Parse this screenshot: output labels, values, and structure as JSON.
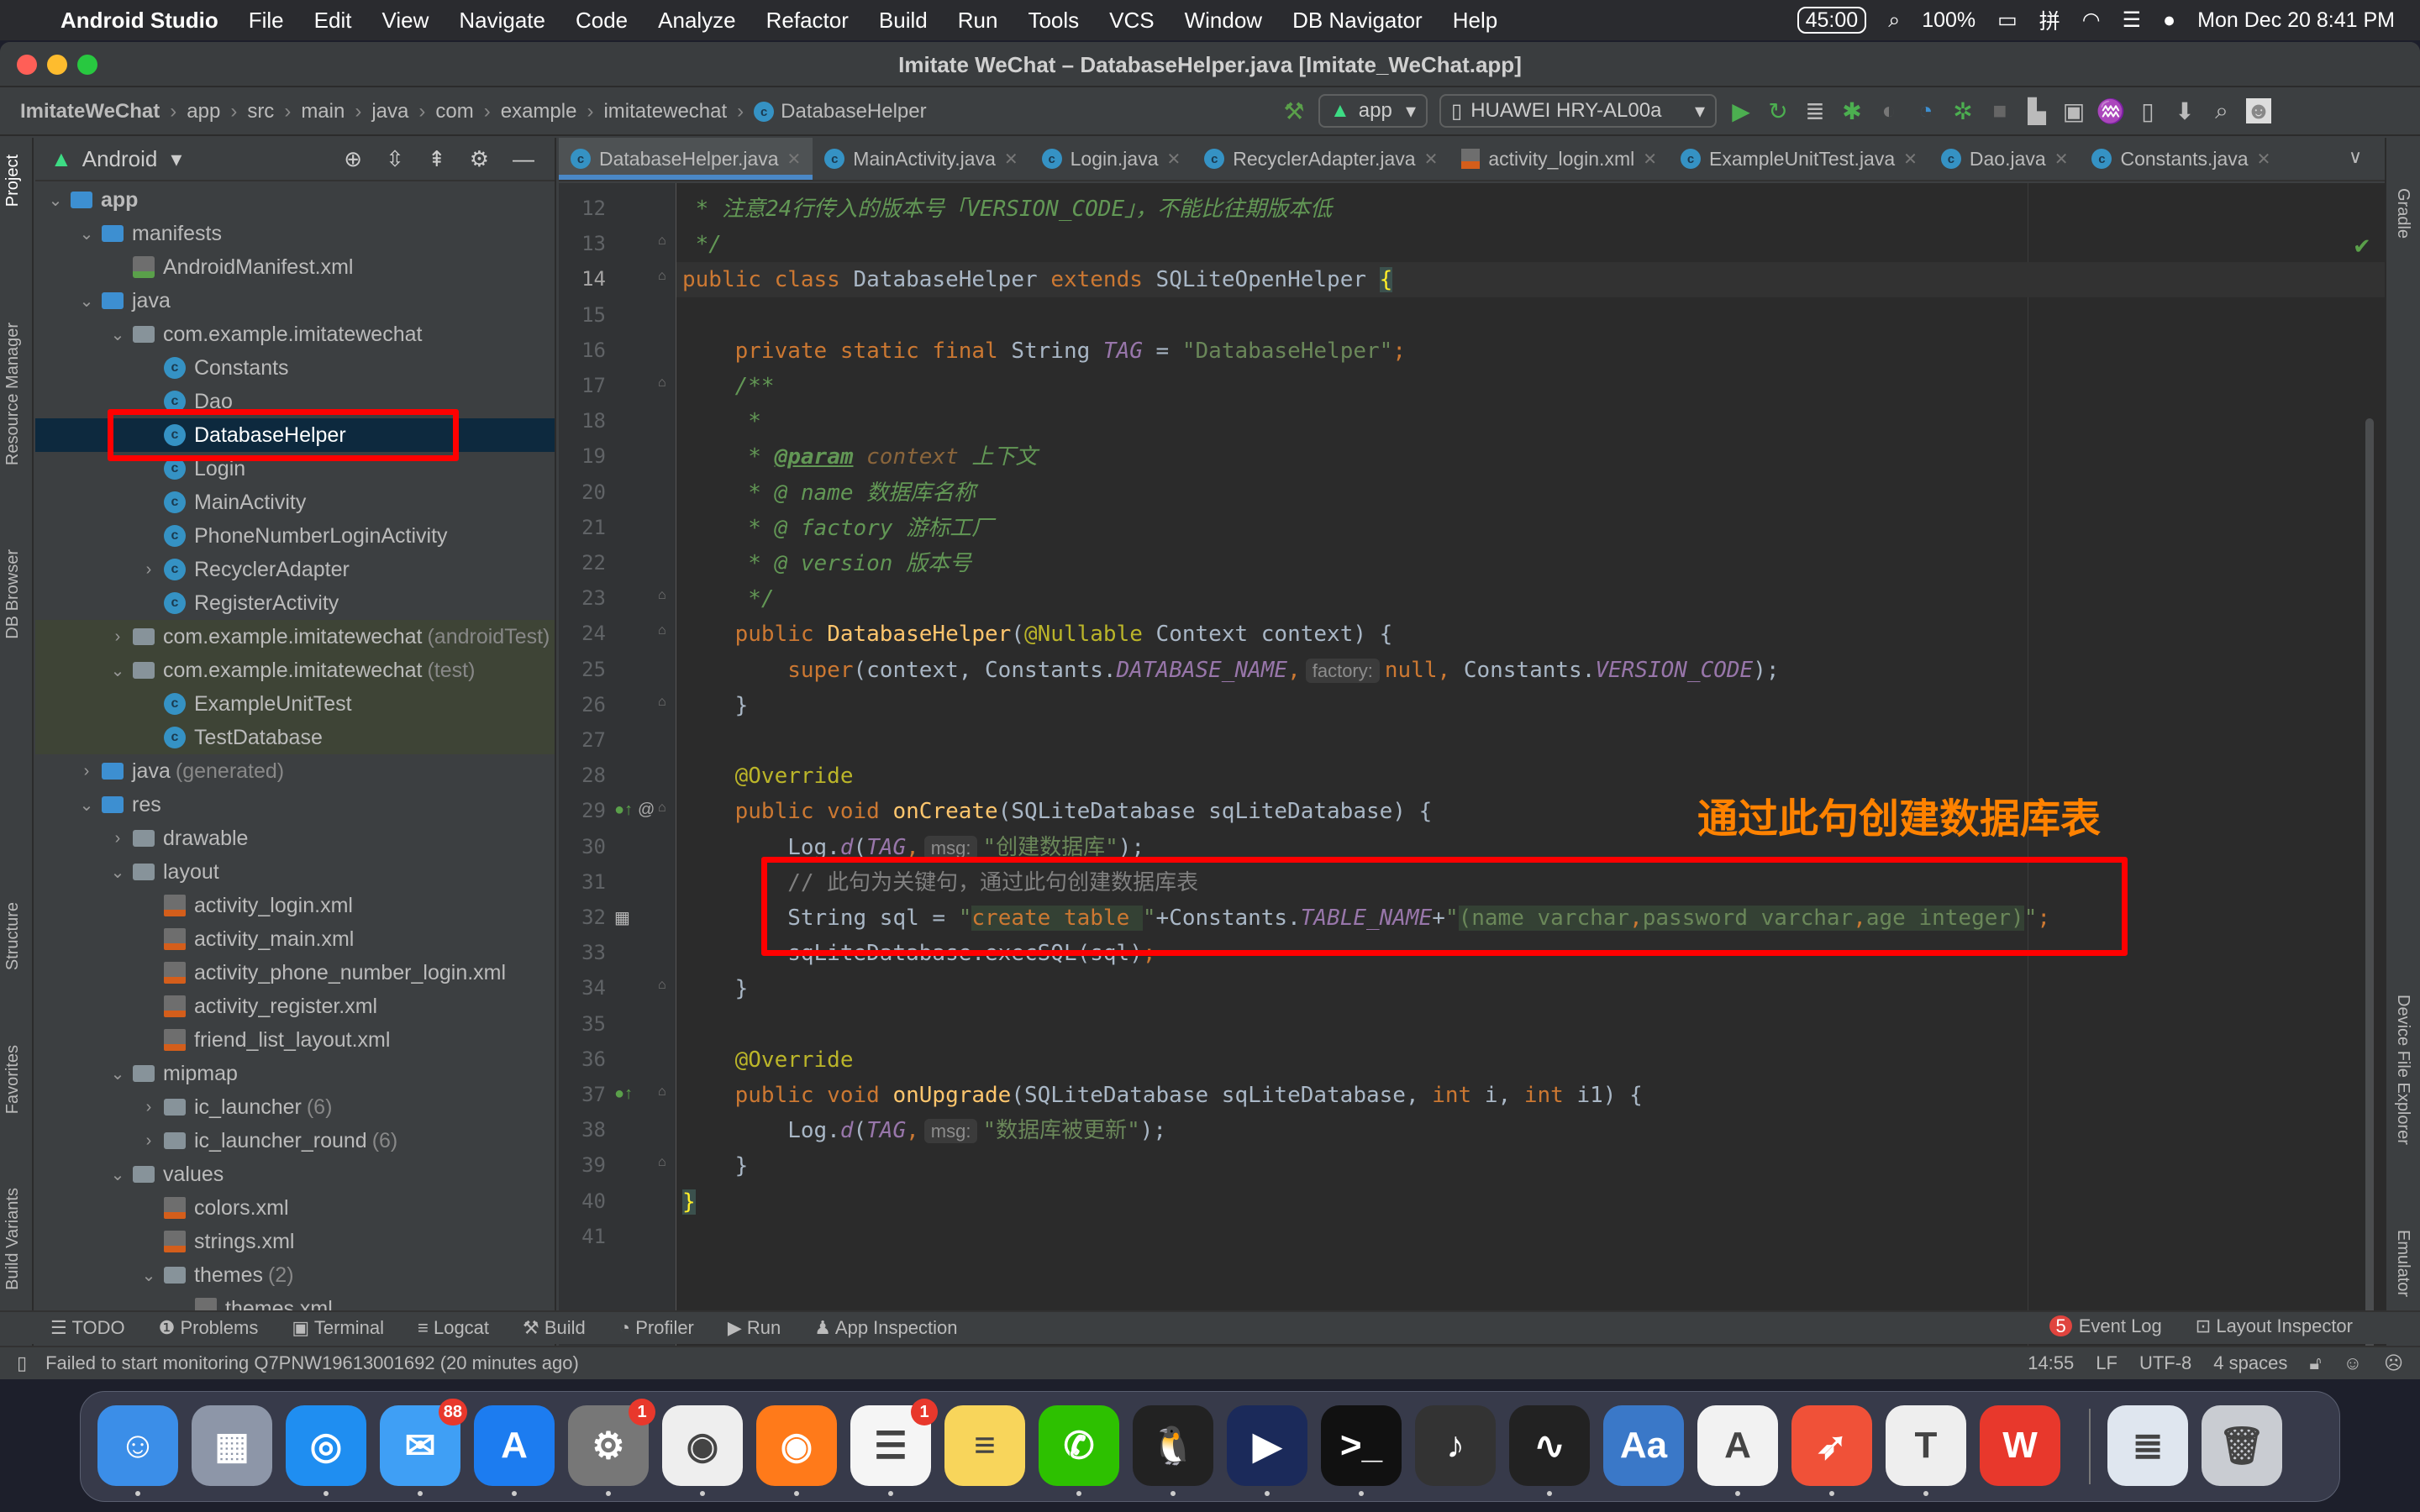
{
  "menubar": {
    "app_name": "Android Studio",
    "items": [
      "File",
      "Edit",
      "View",
      "Navigate",
      "Code",
      "Analyze",
      "Refactor",
      "Build",
      "Run",
      "Tools",
      "VCS",
      "Window",
      "DB Navigator",
      "Help"
    ],
    "timer": "45:00",
    "battery": "100%",
    "datetime": "Mon Dec 20  8:41 PM"
  },
  "window": {
    "title": "Imitate WeChat – DatabaseHelper.java [Imitate_WeChat.app]"
  },
  "breadcrumb": [
    "ImitateWeChat",
    "app",
    "src",
    "main",
    "java",
    "com",
    "example",
    "imitatewechat",
    "DatabaseHelper"
  ],
  "toolbar": {
    "run_config": "app",
    "device": "HUAWEI HRY-AL00a"
  },
  "left_tool_windows": [
    "Project",
    "Resource Manager",
    "DB Browser",
    "Structure",
    "Favorites",
    "Build Variants"
  ],
  "right_tool_windows": [
    "Gradle",
    "Device File Explorer",
    "Emulator"
  ],
  "project_panel": {
    "view": "Android",
    "tree": [
      {
        "level": 0,
        "arrow": "open",
        "icon": "folderb",
        "label": "app",
        "bold": true
      },
      {
        "level": 1,
        "arrow": "open",
        "icon": "folderb",
        "label": "manifests"
      },
      {
        "level": 2,
        "arrow": "",
        "icon": "man",
        "label": "AndroidManifest.xml"
      },
      {
        "level": 1,
        "arrow": "open",
        "icon": "folderb",
        "label": "java"
      },
      {
        "level": 2,
        "arrow": "open",
        "icon": "pkg",
        "label": "com.example.imitatewechat"
      },
      {
        "level": 3,
        "arrow": "",
        "icon": "cls",
        "label": "Constants"
      },
      {
        "level": 3,
        "arrow": "",
        "icon": "cls",
        "label": "Dao"
      },
      {
        "level": 3,
        "arrow": "",
        "icon": "cls",
        "label": "DatabaseHelper",
        "selected": true
      },
      {
        "level": 3,
        "arrow": "",
        "icon": "cls",
        "label": "Login"
      },
      {
        "level": 3,
        "arrow": "",
        "icon": "cls",
        "label": "MainActivity"
      },
      {
        "level": 3,
        "arrow": "",
        "icon": "cls",
        "label": "PhoneNumberLoginActivity"
      },
      {
        "level": 3,
        "arrow": "closed",
        "icon": "cls",
        "label": "RecyclerAdapter"
      },
      {
        "level": 3,
        "arrow": "",
        "icon": "cls",
        "label": "RegisterActivity"
      },
      {
        "level": 2,
        "arrow": "closed",
        "icon": "pkg",
        "label": "com.example.imitatewechat",
        "secondary": "(androidTest)",
        "test": true
      },
      {
        "level": 2,
        "arrow": "open",
        "icon": "pkg",
        "label": "com.example.imitatewechat",
        "secondary": "(test)",
        "test": true
      },
      {
        "level": 3,
        "arrow": "",
        "icon": "cls",
        "label": "ExampleUnitTest",
        "test": true
      },
      {
        "level": 3,
        "arrow": "",
        "icon": "cls",
        "label": "TestDatabase",
        "test": true
      },
      {
        "level": 1,
        "arrow": "closed",
        "icon": "folderb",
        "label": "java",
        "secondary": "(generated)"
      },
      {
        "level": 1,
        "arrow": "open",
        "icon": "folderb",
        "label": "res"
      },
      {
        "level": 2,
        "arrow": "closed",
        "icon": "folder",
        "label": "drawable"
      },
      {
        "level": 2,
        "arrow": "open",
        "icon": "folder",
        "label": "layout"
      },
      {
        "level": 3,
        "arrow": "",
        "icon": "xml",
        "label": "activity_login.xml"
      },
      {
        "level": 3,
        "arrow": "",
        "icon": "xml",
        "label": "activity_main.xml"
      },
      {
        "level": 3,
        "arrow": "",
        "icon": "xml",
        "label": "activity_phone_number_login.xml"
      },
      {
        "level": 3,
        "arrow": "",
        "icon": "xml",
        "label": "activity_register.xml"
      },
      {
        "level": 3,
        "arrow": "",
        "icon": "xml",
        "label": "friend_list_layout.xml"
      },
      {
        "level": 2,
        "arrow": "open",
        "icon": "folder",
        "label": "mipmap"
      },
      {
        "level": 3,
        "arrow": "closed",
        "icon": "folder",
        "label": "ic_launcher",
        "secondary": "(6)"
      },
      {
        "level": 3,
        "arrow": "closed",
        "icon": "folder",
        "label": "ic_launcher_round",
        "secondary": "(6)"
      },
      {
        "level": 2,
        "arrow": "open",
        "icon": "folder",
        "label": "values"
      },
      {
        "level": 3,
        "arrow": "",
        "icon": "xml",
        "label": "colors.xml"
      },
      {
        "level": 3,
        "arrow": "",
        "icon": "xml",
        "label": "strings.xml"
      },
      {
        "level": 3,
        "arrow": "open",
        "icon": "folder",
        "label": "themes",
        "secondary": "(2)"
      },
      {
        "level": 4,
        "arrow": "",
        "icon": "xml",
        "label": "themes.xml"
      }
    ]
  },
  "editor_tabs": [
    {
      "label": "DatabaseHelper.java",
      "type": "class",
      "active": true
    },
    {
      "label": "MainActivity.java",
      "type": "class"
    },
    {
      "label": "Login.java",
      "type": "class"
    },
    {
      "label": "RecyclerAdapter.java",
      "type": "class"
    },
    {
      "label": "activity_login.xml",
      "type": "xml"
    },
    {
      "label": "ExampleUnitTest.java",
      "type": "class"
    },
    {
      "label": "Dao.java",
      "type": "class"
    },
    {
      "label": "Constants.java",
      "type": "class"
    }
  ],
  "code": {
    "current_line": 14,
    "lines": [
      {
        "n": 12,
        "t": [
          [
            " * 注意24行传入的版本号「VERSION_CODE」，不能比往期版本低",
            "d"
          ]
        ]
      },
      {
        "n": 13,
        "t": [
          [
            " */",
            "d"
          ]
        ]
      },
      {
        "n": 14,
        "t": [
          [
            "public class ",
            "k"
          ],
          [
            "DatabaseHelper ",
            "t"
          ],
          [
            "extends ",
            "k"
          ],
          [
            "SQLiteOpenHelper ",
            "t"
          ],
          [
            "{",
            "br"
          ]
        ]
      },
      {
        "n": 15,
        "t": []
      },
      {
        "n": 16,
        "t": [
          [
            "    private static final ",
            "k"
          ],
          [
            "String ",
            "t"
          ],
          [
            "TAG",
            "f"
          ],
          [
            " = ",
            "t"
          ],
          [
            "\"DatabaseHelper\"",
            "s"
          ],
          [
            ";",
            "k"
          ]
        ]
      },
      {
        "n": 17,
        "t": [
          [
            "    /**",
            "d"
          ]
        ]
      },
      {
        "n": 18,
        "t": [
          [
            "     *",
            "d"
          ]
        ]
      },
      {
        "n": 19,
        "t": [
          [
            "     * ",
            "d"
          ],
          [
            "@param",
            "dt"
          ],
          [
            " context ",
            "dp"
          ],
          [
            "上下文",
            "d"
          ]
        ]
      },
      {
        "n": 20,
        "t": [
          [
            "     * @ name 数据库名称",
            "d"
          ]
        ]
      },
      {
        "n": 21,
        "t": [
          [
            "     * @ factory 游标工厂",
            "d"
          ]
        ]
      },
      {
        "n": 22,
        "t": [
          [
            "     * @ version 版本号",
            "d"
          ]
        ]
      },
      {
        "n": 23,
        "t": [
          [
            "     */",
            "d"
          ]
        ]
      },
      {
        "n": 24,
        "t": [
          [
            "    public ",
            "k"
          ],
          [
            "DatabaseHelper",
            "m"
          ],
          [
            "(",
            "t"
          ],
          [
            "@Nullable ",
            "a"
          ],
          [
            "Context context) {",
            "t"
          ]
        ]
      },
      {
        "n": 25,
        "t": [
          [
            "        super",
            "k"
          ],
          [
            "(context, Constants.",
            "t"
          ],
          [
            "DATABASE_NAME",
            "f"
          ],
          [
            ",",
            "k"
          ],
          [
            "factory:",
            "h"
          ],
          [
            "null",
            "k"
          ],
          [
            ", ",
            "k"
          ],
          [
            "Constants.",
            "t"
          ],
          [
            "VERSION_CODE",
            "f"
          ],
          [
            ");",
            "t"
          ]
        ]
      },
      {
        "n": 26,
        "t": [
          [
            "    }",
            "t"
          ]
        ]
      },
      {
        "n": 27,
        "t": []
      },
      {
        "n": 28,
        "t": [
          [
            "    @Override",
            "a"
          ]
        ]
      },
      {
        "n": 29,
        "t": [
          [
            "    public void ",
            "k"
          ],
          [
            "onCreate",
            "m"
          ],
          [
            "(SQLiteDatabase sqLiteDatabase) {",
            "t"
          ]
        ]
      },
      {
        "n": 30,
        "t": [
          [
            "        Log.",
            "t"
          ],
          [
            "d",
            "f"
          ],
          [
            "(",
            "t"
          ],
          [
            "TAG",
            "f"
          ],
          [
            ",",
            "k"
          ],
          [
            "msg:",
            "h"
          ],
          [
            "\"创建数据库\"",
            "s"
          ],
          [
            ");",
            "t"
          ]
        ]
      },
      {
        "n": 31,
        "t": [
          [
            "        // 此句为关键句，通过此句创建数据库表",
            "c"
          ]
        ]
      },
      {
        "n": 32,
        "t": [
          [
            "        String sql = ",
            "t"
          ],
          [
            "\"",
            "s"
          ],
          [
            "create table ",
            "sb"
          ],
          [
            "\"",
            "s"
          ],
          [
            "+Constants.",
            "t"
          ],
          [
            "TABLE_NAME",
            "f"
          ],
          [
            "+",
            "t"
          ],
          [
            "\"",
            "s"
          ],
          [
            "(name varchar",
            "sg"
          ],
          [
            ",",
            "sb"
          ],
          [
            "password varchar",
            "sg"
          ],
          [
            ",",
            "sb"
          ],
          [
            "age integer)",
            "sg"
          ],
          [
            "\"",
            "s"
          ],
          [
            ";",
            "k"
          ]
        ]
      },
      {
        "n": 33,
        "t": [
          [
            "        sqLiteDatabase.execSQL(sql)",
            "t"
          ],
          [
            ";",
            "k"
          ]
        ]
      },
      {
        "n": 34,
        "t": [
          [
            "    }",
            "t"
          ]
        ]
      },
      {
        "n": 35,
        "t": []
      },
      {
        "n": 36,
        "t": [
          [
            "    @Override",
            "a"
          ]
        ]
      },
      {
        "n": 37,
        "t": [
          [
            "    public void ",
            "k"
          ],
          [
            "onUpgrade",
            "m"
          ],
          [
            "(SQLiteDatabase sqLiteDatabase, ",
            "t"
          ],
          [
            "int ",
            "k"
          ],
          [
            "i, ",
            "t"
          ],
          [
            "int ",
            "k"
          ],
          [
            "i1) {",
            "t"
          ]
        ]
      },
      {
        "n": 38,
        "t": [
          [
            "        Log.",
            "t"
          ],
          [
            "d",
            "f"
          ],
          [
            "(",
            "t"
          ],
          [
            "TAG",
            "f"
          ],
          [
            ",",
            "k"
          ],
          [
            "msg:",
            "h"
          ],
          [
            "\"数据库被更新\"",
            "s"
          ],
          [
            ");",
            "t"
          ]
        ]
      },
      {
        "n": 39,
        "t": [
          [
            "    }",
            "t"
          ]
        ]
      },
      {
        "n": 40,
        "t": [
          [
            "}",
            "br"
          ]
        ]
      },
      {
        "n": 41,
        "t": []
      }
    ]
  },
  "annotation": {
    "text": "通过此句创建数据库表",
    "color": "#ff0000"
  },
  "bottom_tools": [
    "TODO",
    "Problems",
    "Terminal",
    "Logcat",
    "Build",
    "Profiler",
    "Run",
    "App Inspection"
  ],
  "bottom_right": {
    "event_log": "Event Log",
    "event_count": "5",
    "layout_inspector": "Layout Inspector"
  },
  "status": {
    "message": "Failed to start monitoring Q7PNW19613001692 (20 minutes ago)",
    "position": "14:55",
    "line_sep": "LF",
    "encoding": "UTF-8",
    "indent": "4 spaces"
  },
  "dock": [
    {
      "name": "finder",
      "color": "#3b8ee8",
      "glyph": "☺"
    },
    {
      "name": "launchpad",
      "color": "#8d96a8",
      "glyph": "▦"
    },
    {
      "name": "safari",
      "color": "#1f8ef1",
      "glyph": "◎"
    },
    {
      "name": "mail",
      "color": "#3f9ff5",
      "glyph": "✉",
      "badge": "88"
    },
    {
      "name": "app-store",
      "color": "#1c7cf0",
      "glyph": "A"
    },
    {
      "name": "system-preferences",
      "color": "#777",
      "glyph": "⚙",
      "badge": "1"
    },
    {
      "name": "chrome",
      "color": "#eeeeee",
      "glyph": "◉"
    },
    {
      "name": "firefox",
      "color": "#ff7a1a",
      "glyph": "◉"
    },
    {
      "name": "reminders",
      "color": "#f5f5f5",
      "glyph": "☰",
      "badge": "1"
    },
    {
      "name": "notes",
      "color": "#f8d55b",
      "glyph": "≡"
    },
    {
      "name": "wechat",
      "color": "#2dc100",
      "glyph": "✆"
    },
    {
      "name": "qq",
      "color": "#222",
      "glyph": "🐧"
    },
    {
      "name": "video-player",
      "color": "#1b2a5a",
      "glyph": "▶"
    },
    {
      "name": "terminal",
      "color": "#111",
      "glyph": ">_"
    },
    {
      "name": "piano",
      "color": "#333",
      "glyph": "♪"
    },
    {
      "name": "activity-monitor",
      "color": "#222",
      "glyph": "∿"
    },
    {
      "name": "dictionary",
      "color": "#3a78c8",
      "glyph": "Aa"
    },
    {
      "name": "android-studio",
      "color": "#f2f2f2",
      "glyph": "A"
    },
    {
      "name": "swift",
      "color": "#f05138",
      "glyph": "➶"
    },
    {
      "name": "typora",
      "color": "#eee",
      "glyph": "T"
    },
    {
      "name": "wps",
      "color": "#e8382c",
      "glyph": "W"
    },
    {
      "name": "docx-file",
      "color": "#dfe6ef",
      "glyph": "≣"
    },
    {
      "name": "trash",
      "color": "#c9ccd2",
      "glyph": "🗑"
    }
  ]
}
